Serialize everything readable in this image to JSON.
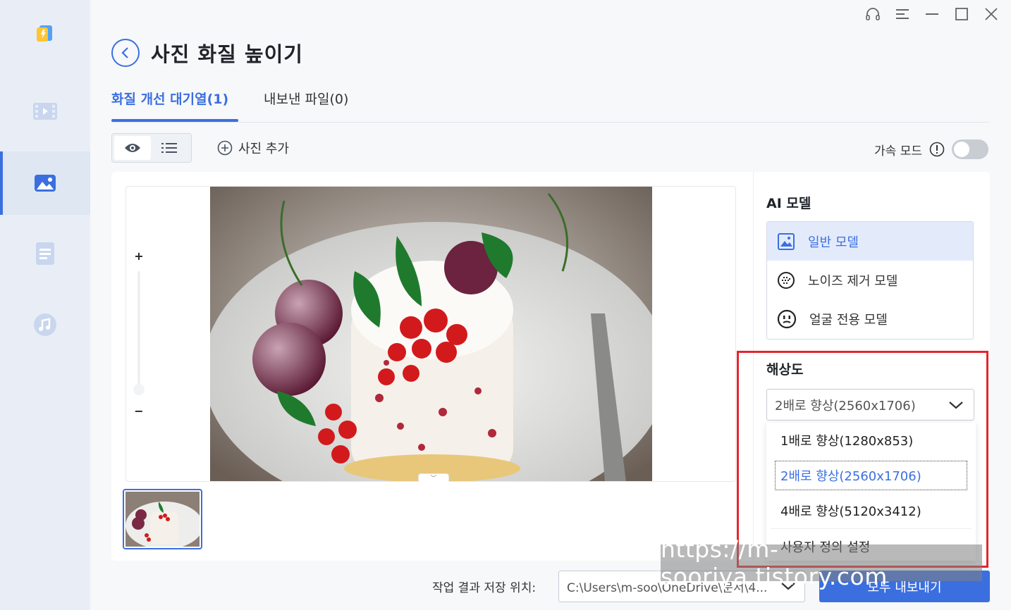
{
  "sidebar": {
    "items": [
      {
        "icon": "video-icon"
      },
      {
        "icon": "image-icon",
        "active": true
      },
      {
        "icon": "document-icon"
      },
      {
        "icon": "music-icon"
      }
    ]
  },
  "window_controls": [
    "headset-icon",
    "menu-icon",
    "minimize-icon",
    "maximize-icon",
    "close-icon"
  ],
  "header": {
    "title": "사진 화질 높이기"
  },
  "tabs": [
    {
      "label": "화질 개선 대기열(1)",
      "active": true
    },
    {
      "label": "내보낸 파일(0)",
      "active": false
    }
  ],
  "toolbar": {
    "add_photo_label": "사진 추가",
    "accel_label": "가속 모드",
    "accel_enabled": false
  },
  "preview": {
    "zoom_in": "+",
    "zoom_out": "−",
    "collapse": "﹀"
  },
  "settings": {
    "ai_model_title": "AI 모델",
    "models": [
      {
        "label": "일반 모델",
        "icon": "picture-icon",
        "selected": true
      },
      {
        "label": "노이즈 제거 모델",
        "icon": "noise-icon",
        "selected": false
      },
      {
        "label": "얼굴 전용 모델",
        "icon": "face-icon",
        "selected": false
      }
    ],
    "resolution_title": "해상도",
    "resolution_selected": "2배로 향상(2560x1706)",
    "resolution_options": [
      "1배로 향상(1280x853)",
      "2배로 향상(2560x1706)",
      "4배로 향상(5120x3412)",
      "사용자 정의 설정"
    ]
  },
  "footer": {
    "save_location_label": "작업 결과 저장 위치:",
    "save_path": "C:\\Users\\m-soo\\OneDrive\\문서\\4...",
    "export_all_label": "모두 내보내기"
  },
  "watermark": "https://m-sooriya.tistory.com",
  "colors": {
    "accent": "#3b6fe0",
    "highlight": "#e3262d"
  }
}
